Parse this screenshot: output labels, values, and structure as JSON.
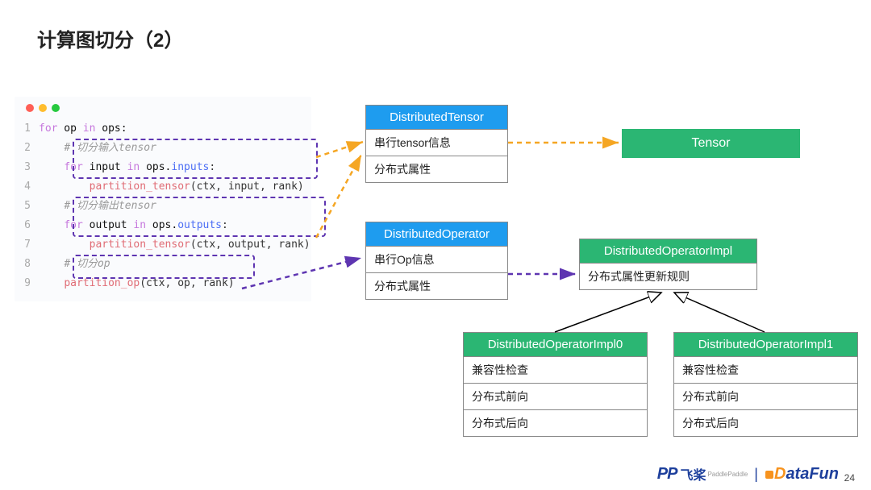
{
  "slide": {
    "title": "计算图切分（2）",
    "page_number": "24"
  },
  "code": {
    "lines": {
      "l1a": "for",
      "l1b": " op ",
      "l1c": "in",
      "l1d": " ops:",
      "l2": "# 切分输入tensor",
      "l3a": "for",
      "l3b": " input ",
      "l3c": "in",
      "l3d": " ops.",
      "l3e": "inputs",
      "l3f": ":",
      "l4": "partition_tensor",
      "l4args": "(ctx, input, rank)",
      "l5": "# 切分输出tensor",
      "l6a": "for",
      "l6b": " output ",
      "l6c": "in",
      "l6d": " ops.",
      "l6e": "outputs",
      "l6f": ":",
      "l7": "partition_tensor",
      "l7args": "(ctx, output, rank)",
      "l8": "# 切分op",
      "l9": "partition_op",
      "l9args": "(ctx, op, rank)"
    }
  },
  "boxes": {
    "dist_tensor": {
      "title": "DistributedTensor",
      "row1": "串行tensor信息",
      "row2": "分布式属性"
    },
    "tensor": {
      "title": "Tensor"
    },
    "dist_op": {
      "title": "DistributedOperator",
      "row1": "串行Op信息",
      "row2": "分布式属性"
    },
    "dist_op_impl": {
      "title": "DistributedOperatorImpl",
      "row1": "分布式属性更新规则"
    },
    "impl0": {
      "title": "DistributedOperatorImpl0",
      "row1": "兼容性检查",
      "row2": "分布式前向",
      "row3": "分布式后向"
    },
    "impl1": {
      "title": "DistributedOperatorImpl1",
      "row1": "兼容性检查",
      "row2": "分布式前向",
      "row3": "分布式后向"
    }
  },
  "logos": {
    "paddle_mark": "PP",
    "paddle_text": "飞桨",
    "paddle_sub": "PaddlePaddle",
    "separator": "|",
    "datafun_d": "D",
    "datafun_rest": "ataFun"
  }
}
